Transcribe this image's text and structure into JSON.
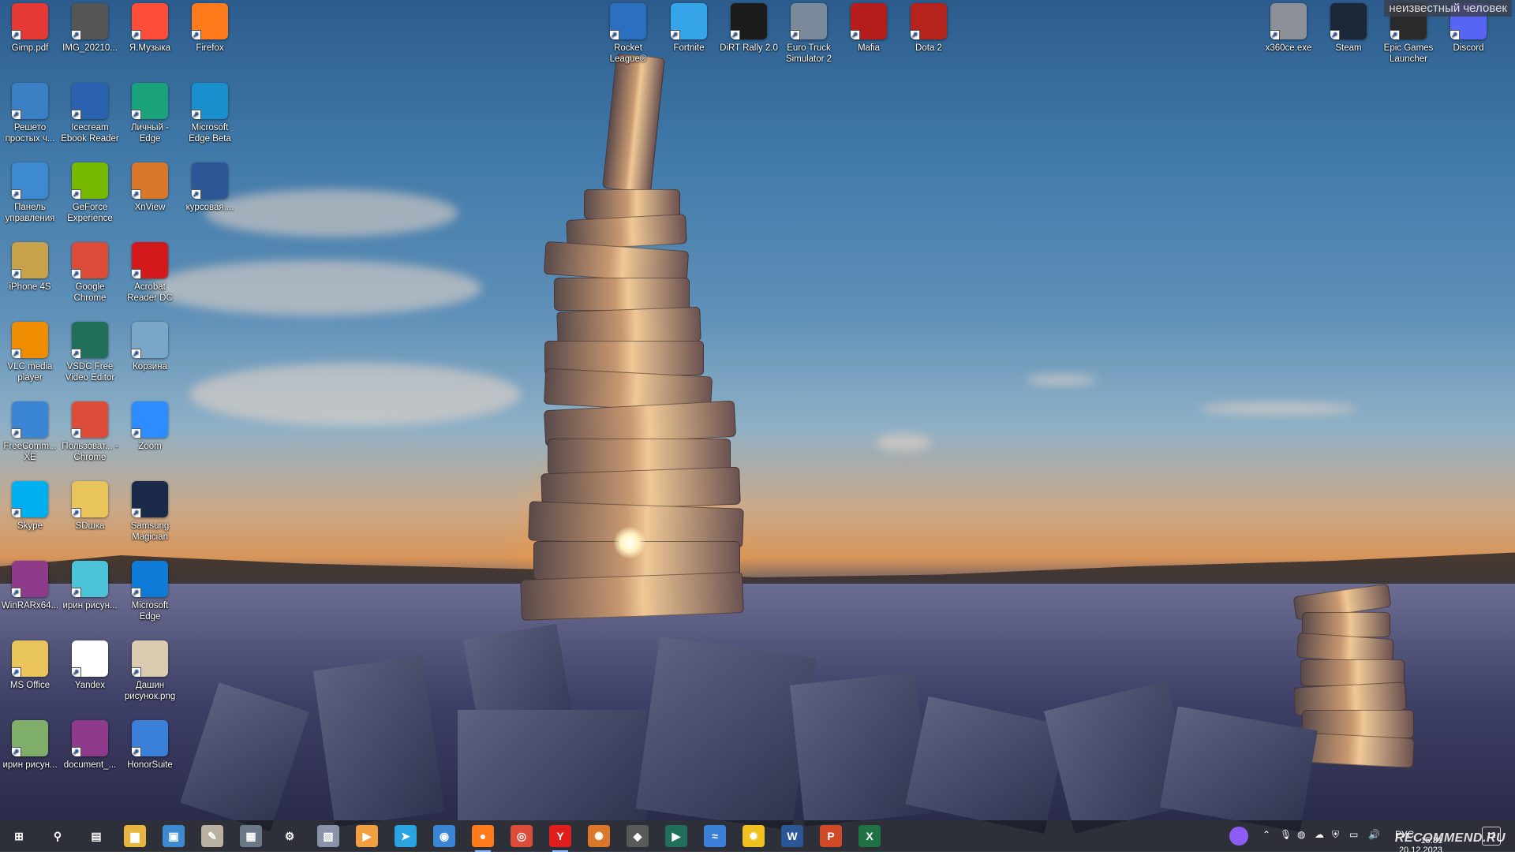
{
  "overlay_text": "неизвестный человек",
  "watermark": "RECOMMEND.RU",
  "clock": {
    "time": "15:31",
    "date": "20.12.2023"
  },
  "tray": {
    "lang": "РУС",
    "notifications": "12"
  },
  "colors": {
    "taskbar": "#1c1e28",
    "accent": "#7fb0ff"
  },
  "desktop_icons": [
    {
      "label": "Gimp.pdf",
      "icon": "pdf-icon",
      "color": "#e53935"
    },
    {
      "label": "IMG_20210...",
      "icon": "image-file-icon",
      "color": "#555555"
    },
    {
      "label": "Я.Музыка",
      "icon": "yandex-music-icon",
      "color": "#ff4d3a"
    },
    {
      "label": "Firefox",
      "icon": "firefox-icon",
      "color": "#ff7a1a"
    },
    {
      "label": "Решето простых ч...",
      "icon": "presentation-file-icon",
      "color": "#3b7fc4"
    },
    {
      "label": "Icecream Ebook Reader",
      "icon": "ebook-reader-icon",
      "color": "#2a62b0"
    },
    {
      "label": "Личный - Edge",
      "icon": "edge-profile-icon",
      "color": "#1aa27a"
    },
    {
      "label": "Microsoft Edge Beta",
      "icon": "edge-beta-icon",
      "color": "#1a8fce"
    },
    {
      "label": "Панель управления",
      "icon": "control-panel-icon",
      "color": "#3d8ad0"
    },
    {
      "label": "GeForce Experience",
      "icon": "nvidia-icon",
      "color": "#76b900"
    },
    {
      "label": "XnView",
      "icon": "xnview-icon",
      "color": "#d9772b"
    },
    {
      "label": "курсовая....",
      "icon": "word-doc-icon",
      "color": "#2b5797"
    },
    {
      "label": "iPhone 4S",
      "icon": "folder-phone-icon",
      "color": "#c7a24a"
    },
    {
      "label": "Google Chrome",
      "icon": "chrome-icon",
      "color": "#dd4b39"
    },
    {
      "label": "Acrobat Reader DC",
      "icon": "acrobat-icon",
      "color": "#d4191d"
    },
    {
      "label": "VLC media player",
      "icon": "vlc-icon",
      "color": "#f08c00"
    },
    {
      "label": "VSDC Free Video Editor",
      "icon": "vsdc-icon",
      "color": "#1f6f5a"
    },
    {
      "label": "Корзина",
      "icon": "recycle-bin-icon",
      "color": "#7aa7c7"
    },
    {
      "label": "FreeComm... XE",
      "icon": "freecommander-icon",
      "color": "#3a86d4"
    },
    {
      "label": "Пользоват... - Chrome",
      "icon": "chrome-profile-icon",
      "color": "#dd4b39"
    },
    {
      "label": "Zoom",
      "icon": "zoom-icon",
      "color": "#2d8cff"
    },
    {
      "label": "Skype",
      "icon": "skype-icon",
      "color": "#00aff0"
    },
    {
      "label": "SDшка",
      "icon": "folder-icon",
      "color": "#e8c45a"
    },
    {
      "label": "Samsung Magician",
      "icon": "samsung-magician-icon",
      "color": "#1c2a4a"
    },
    {
      "label": "WinRARx64...",
      "icon": "winrar-icon",
      "color": "#8e3b8c"
    },
    {
      "label": "ирин рисун...",
      "icon": "image-file-icon",
      "color": "#4cc3d9"
    },
    {
      "label": "Microsoft Edge",
      "icon": "edge-icon",
      "color": "#0f7bd8"
    },
    {
      "label": "MS Office",
      "icon": "folder-icon",
      "color": "#e8c45a"
    },
    {
      "label": "Yandex",
      "icon": "yandex-browser-icon",
      "color": "#ffffff"
    },
    {
      "label": "Дашин рисунок.png",
      "icon": "image-file-icon",
      "color": "#d9cbb0"
    },
    {
      "label": "ирин рисун...",
      "icon": "image-file-icon",
      "color": "#7fae6a"
    },
    {
      "label": "document_...",
      "icon": "winrar-icon",
      "color": "#8e3b8c"
    },
    {
      "label": "HonorSuite",
      "icon": "honorsuite-icon",
      "color": "#3a7fd8"
    },
    {
      "label": "Rocket League®",
      "icon": "rocket-league-icon",
      "color": "#2a6fc0"
    },
    {
      "label": "Fortnite",
      "icon": "fortnite-icon",
      "color": "#35a4e8"
    },
    {
      "label": "DiRT Rally 2.0",
      "icon": "dirt-rally-icon",
      "color": "#1b1b1b"
    },
    {
      "label": "Euro Truck Simulator 2",
      "icon": "truck-icon",
      "color": "#7a8a9a"
    },
    {
      "label": "Mafia",
      "icon": "mafia-icon",
      "color": "#b51d1d"
    },
    {
      "label": "Dota 2",
      "icon": "dota-icon",
      "color": "#b5241c"
    },
    {
      "label": "x360ce.exe",
      "icon": "gamepad-icon",
      "color": "#8a8f98"
    },
    {
      "label": "Steam",
      "icon": "steam-icon",
      "color": "#1b2838"
    },
    {
      "label": "Epic Games Launcher",
      "icon": "epic-games-icon",
      "color": "#2a2a2a"
    },
    {
      "label": "Discord",
      "icon": "discord-icon",
      "color": "#5865f2"
    }
  ],
  "taskbar_items": [
    {
      "icon": "windows-start-icon",
      "glyph": "⊞",
      "color": "transparent"
    },
    {
      "icon": "search-icon",
      "glyph": "⚲",
      "color": "transparent"
    },
    {
      "icon": "task-view-icon",
      "glyph": "▤",
      "color": "transparent"
    },
    {
      "icon": "file-explorer-icon",
      "glyph": "▆",
      "color": "#e8b540"
    },
    {
      "icon": "app-icon",
      "glyph": "▣",
      "color": "#3d8ad0"
    },
    {
      "icon": "paint-icon",
      "glyph": "✎",
      "color": "#b9b0a0"
    },
    {
      "icon": "calculator-icon",
      "glyph": "▦",
      "color": "#6a7888"
    },
    {
      "icon": "settings-icon",
      "glyph": "⚙",
      "color": "transparent"
    },
    {
      "icon": "photos-icon",
      "glyph": "▧",
      "color": "#8a94a8"
    },
    {
      "icon": "media-player-icon",
      "glyph": "▶",
      "color": "#f0a040"
    },
    {
      "icon": "telegram-icon",
      "glyph": "➤",
      "color": "#2aa3e0"
    },
    {
      "icon": "freecommander-icon",
      "glyph": "◉",
      "color": "#3a86d4"
    },
    {
      "icon": "firefox-icon",
      "glyph": "●",
      "color": "#ff7a1a"
    },
    {
      "icon": "chrome-icon",
      "glyph": "◎",
      "color": "#dd4b39"
    },
    {
      "icon": "yandex-browser-icon",
      "glyph": "Y",
      "color": "#e11d1d"
    },
    {
      "icon": "xnview-icon",
      "glyph": "✺",
      "color": "#d9772b"
    },
    {
      "icon": "app-icon",
      "glyph": "◆",
      "color": "#5a5a5a"
    },
    {
      "icon": "vsdc-icon",
      "glyph": "▶",
      "color": "#1f6f5a"
    },
    {
      "icon": "honorsuite-icon",
      "glyph": "≈",
      "color": "#3a7fd8"
    },
    {
      "icon": "app-icon",
      "glyph": "✹",
      "color": "#f0c020"
    },
    {
      "icon": "word-icon",
      "glyph": "W",
      "color": "#2b5797"
    },
    {
      "icon": "powerpoint-icon",
      "glyph": "P",
      "color": "#d04a26"
    },
    {
      "icon": "excel-icon",
      "glyph": "X",
      "color": "#1f7244"
    }
  ]
}
